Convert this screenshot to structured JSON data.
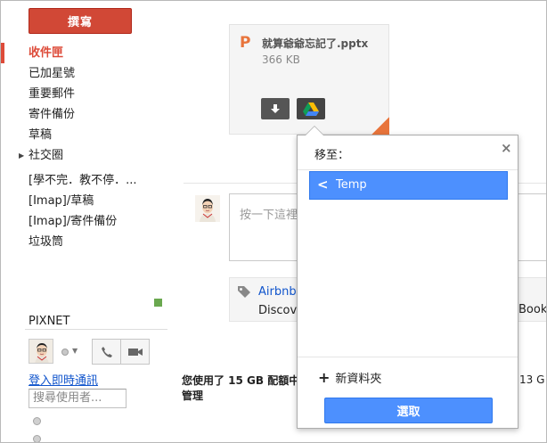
{
  "compose_label": "撰寫",
  "nav": [
    {
      "label": "收件匣",
      "active": true
    },
    {
      "label": "已加星號"
    },
    {
      "label": "重要郵件"
    },
    {
      "label": "寄件備份"
    },
    {
      "label": "草稿"
    },
    {
      "label": "社交圈",
      "expandable": true
    },
    {
      "label": "[學不完．教不停．..."
    },
    {
      "label": "[Imap]/草稿"
    },
    {
      "label": "[Imap]/寄件備份"
    },
    {
      "label": "垃圾筒"
    }
  ],
  "chat": {
    "section_title": "PIXNET",
    "signin_link": "登入即時通訊",
    "search_placeholder": "搜尋使用者..."
  },
  "attachment": {
    "icon_letter": "P",
    "filename": "就算爺爺忘記了.pptx",
    "size": "366 KB",
    "icons": [
      "download-icon",
      "drive-icon"
    ]
  },
  "reply": {
    "placeholder": "按一下這裡"
  },
  "ad": {
    "title": "Airbnb -",
    "description": "Discove",
    "right_fragment": "Book"
  },
  "quota": {
    "line1": "您使用了 15 GB 配額中",
    "line2": "管理",
    "right_fragment": "13 G"
  },
  "move_popup": {
    "title": "移至：",
    "close_symbol": "×",
    "folder": "Temp",
    "new_folder_label": "新資料夾",
    "select_button": "選取"
  },
  "colors": {
    "compose": "#d14836",
    "active_nav": "#dd4b39",
    "link": "#1155cc",
    "primary_button": "#4d90fe",
    "pptx_orange": "#e8743b"
  }
}
